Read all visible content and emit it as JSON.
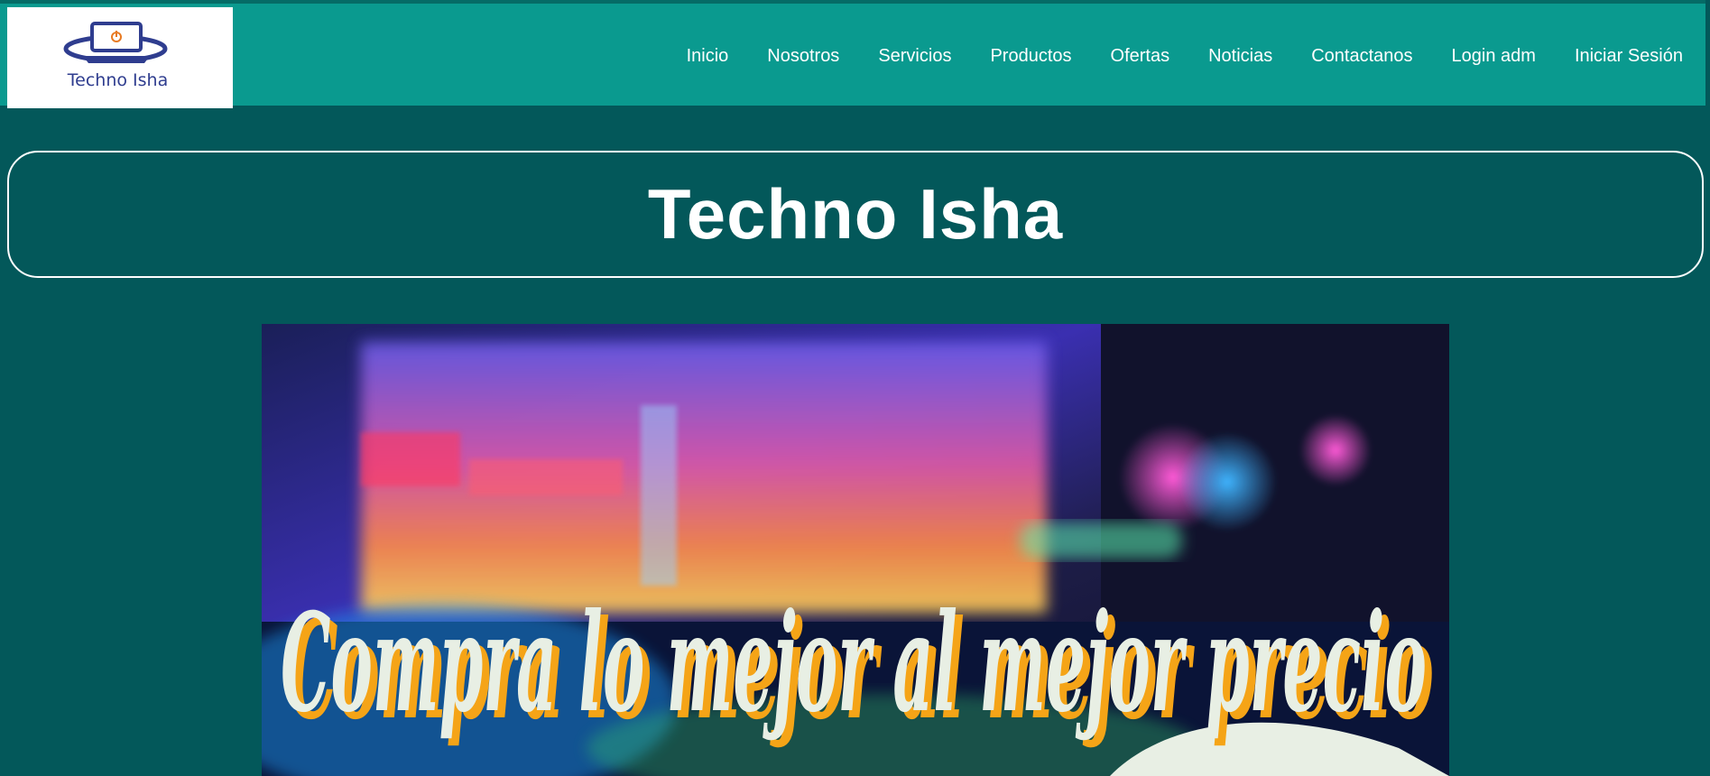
{
  "brand": {
    "logo_text": "Techno Isha"
  },
  "nav": {
    "items": [
      {
        "label": "Inicio",
        "name": "nav-link-inicio"
      },
      {
        "label": "Nosotros",
        "name": "nav-link-nosotros"
      },
      {
        "label": "Servicios",
        "name": "nav-link-servicios"
      },
      {
        "label": "Productos",
        "name": "nav-link-productos"
      },
      {
        "label": "Ofertas",
        "name": "nav-link-ofertas"
      },
      {
        "label": "Noticias",
        "name": "nav-link-noticias"
      },
      {
        "label": "Contactanos",
        "name": "nav-link-contactanos"
      },
      {
        "label": "Login adm",
        "name": "nav-link-login-adm"
      },
      {
        "label": "Iniciar Sesión",
        "name": "nav-link-iniciar-sesion"
      }
    ]
  },
  "banner": {
    "title": "Techno Isha"
  },
  "hero": {
    "slogan": "Compra lo mejor al mejor precio"
  },
  "colors": {
    "page_background": "#03585a",
    "navbar_background": "#0a9a8f",
    "nav_text": "#ffffff",
    "logo_text": "#2f3d8f",
    "slogan_fill": "#e8efe4",
    "slogan_shadow": "#f5a417"
  }
}
